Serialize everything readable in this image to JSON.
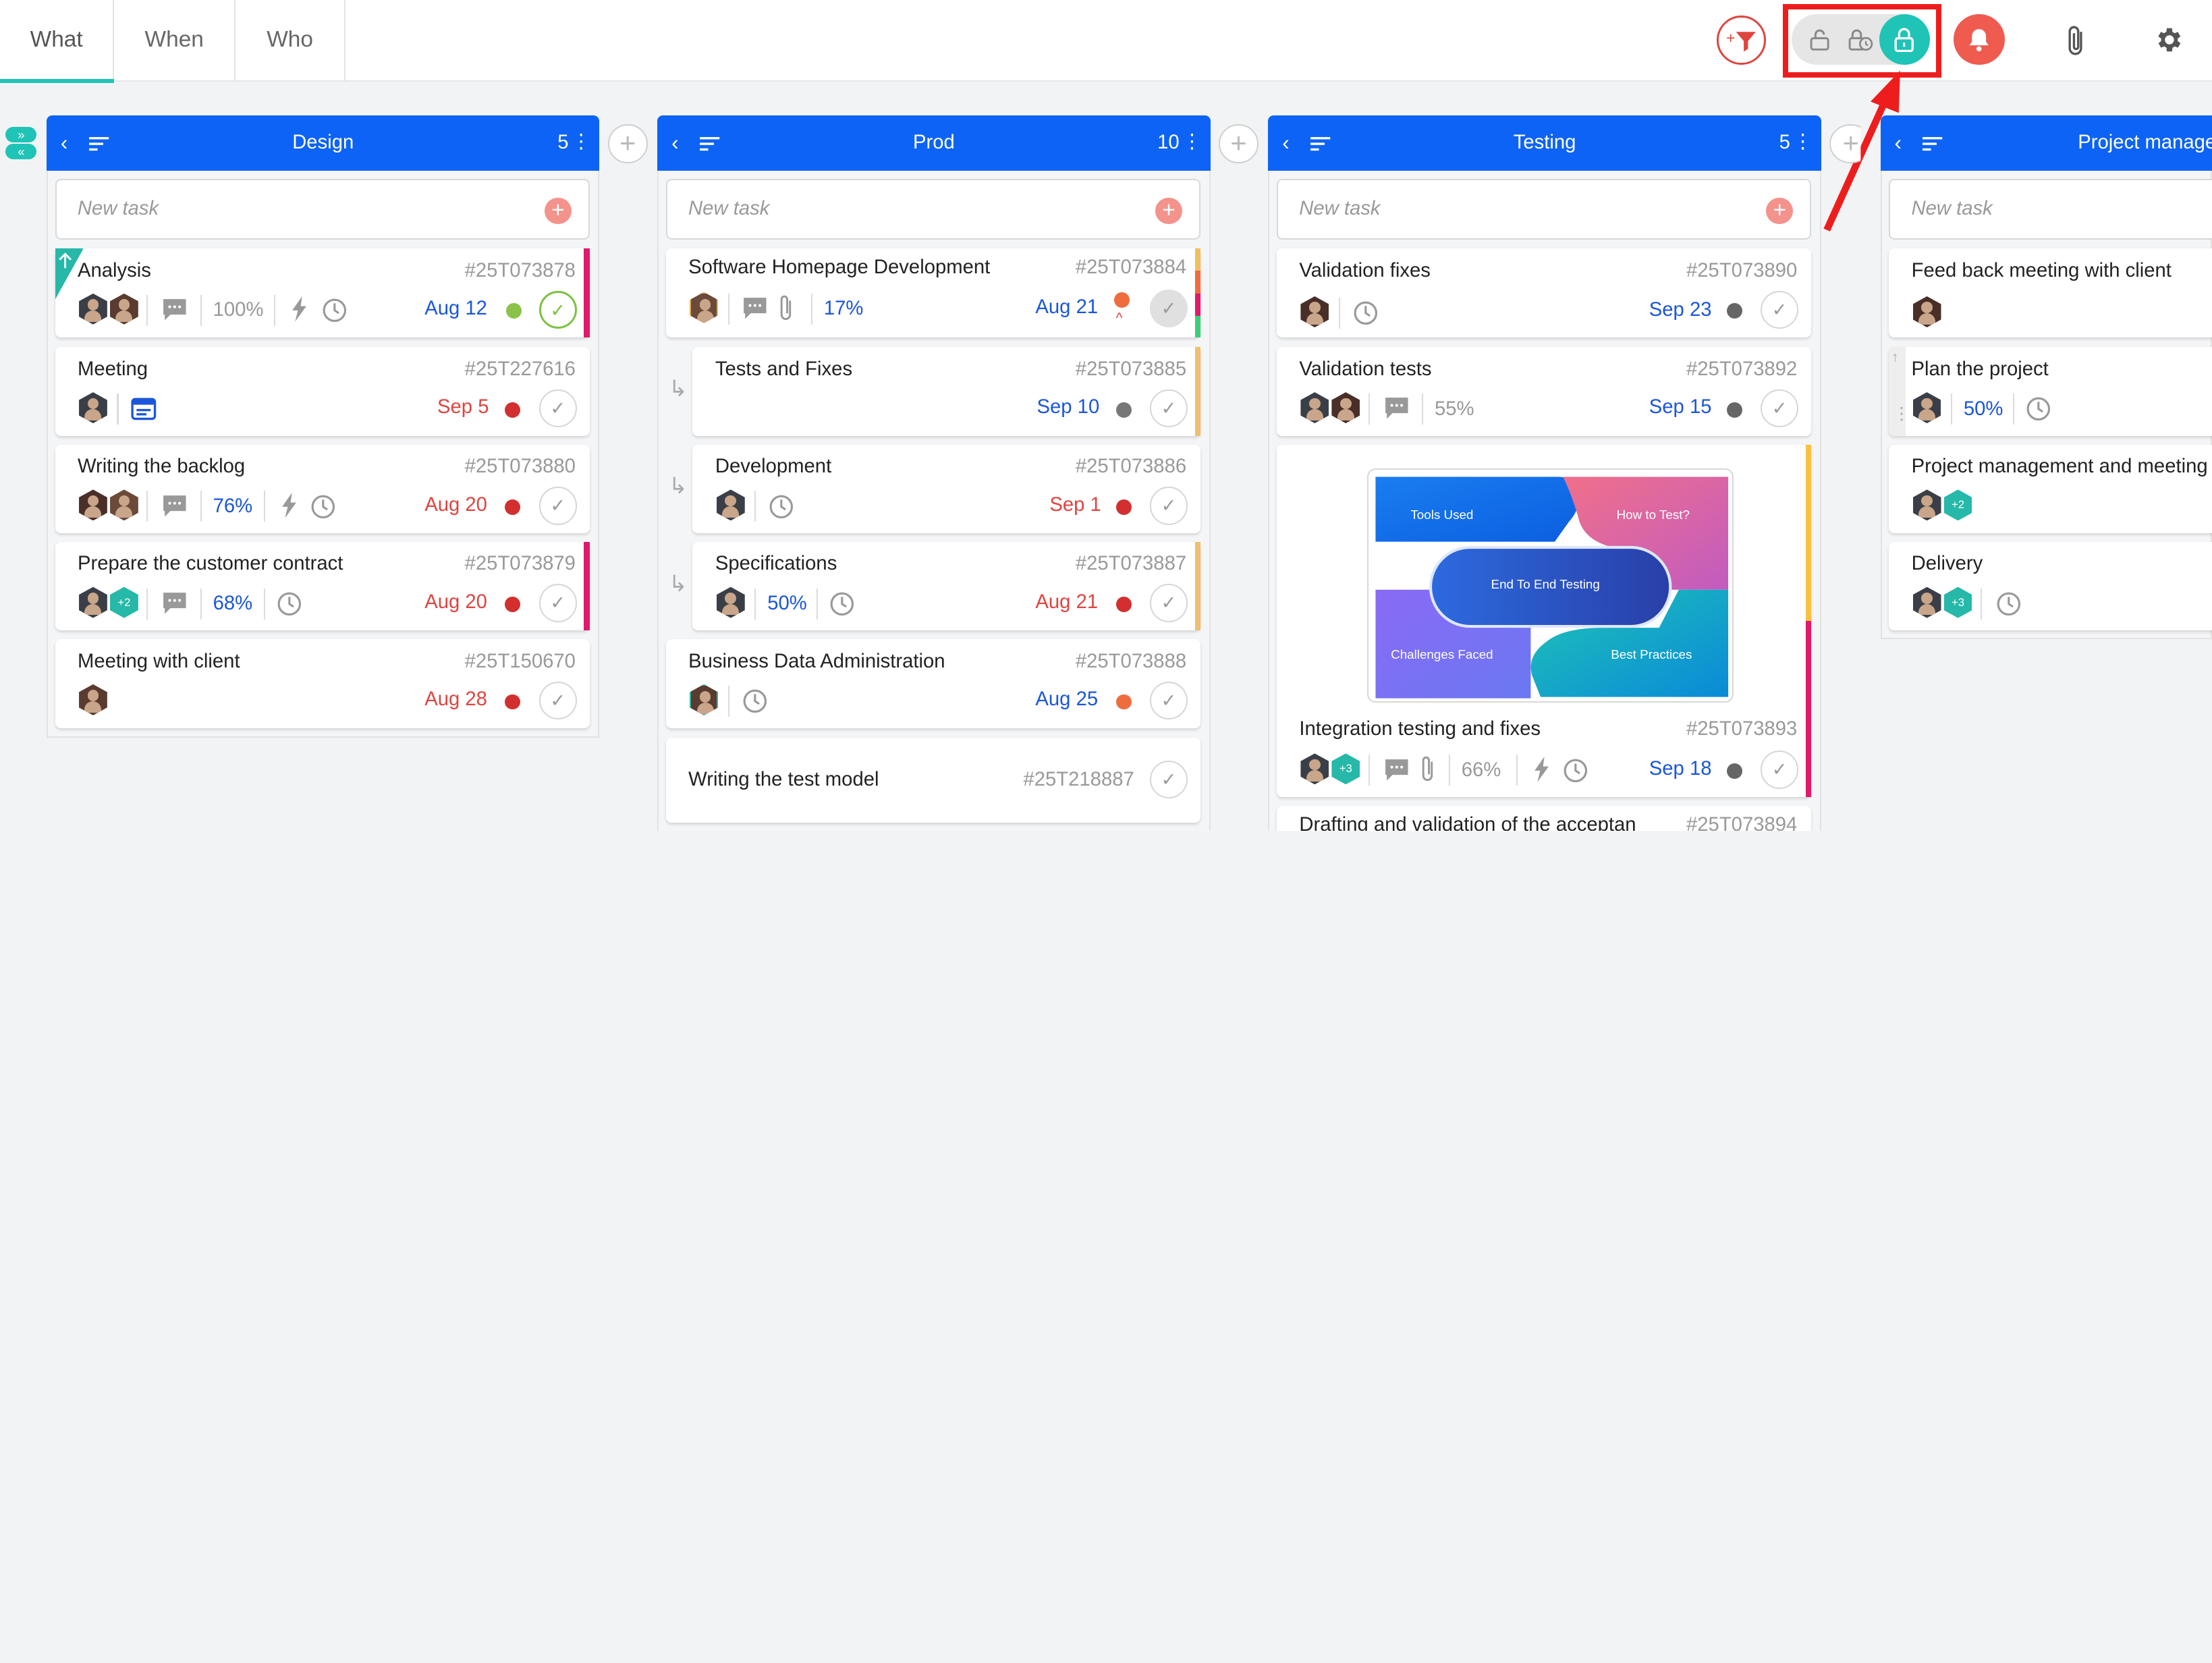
{
  "tabs": [
    {
      "label": "What"
    },
    {
      "label": "When"
    },
    {
      "label": "Who"
    }
  ],
  "colors": {
    "accent": "#1fc4b6",
    "header_blue": "#0d63f5",
    "overdue": "#e0443e",
    "date_blue": "#1a56db",
    "highlight": "#ee1d1d"
  },
  "toolbar_icons": [
    "add-filter-icon",
    "lock-open-icon",
    "lock-clock-icon",
    "lock-active-icon",
    "bell-icon",
    "paperclip-icon",
    "gear-icon"
  ],
  "new_task_placeholder": "New task",
  "columns": [
    {
      "title": "Design",
      "count": "5"
    },
    {
      "title": "Prod",
      "count": "10"
    },
    {
      "title": "Testing",
      "count": "5"
    },
    {
      "title": "Project manage",
      "count": ""
    }
  ],
  "design": [
    {
      "title": "Analysis",
      "id": "#25T073878",
      "progress": "100%",
      "date": "Aug 12"
    },
    {
      "title": "Meeting",
      "id": "#25T227616",
      "date": "Sep 5"
    },
    {
      "title": "Writing the backlog",
      "id": "#25T073880",
      "progress": "76%",
      "date": "Aug 20"
    },
    {
      "title": "Prepare the customer contract",
      "id": "#25T073879",
      "extra": "+2",
      "progress": "68%",
      "date": "Aug 20"
    },
    {
      "title": "Meeting with client",
      "id": "#25T150670",
      "date": "Aug 28"
    }
  ],
  "prod": [
    {
      "title": "Software Homepage Development",
      "id": "#25T073884",
      "progress": "17%",
      "date": "Aug 21"
    },
    {
      "title": "Tests and Fixes",
      "id": "#25T073885",
      "date": "Sep 10"
    },
    {
      "title": "Development",
      "id": "#25T073886",
      "date": "Sep 1"
    },
    {
      "title": "Specifications",
      "id": "#25T073887",
      "progress": "50%",
      "date": "Aug 21"
    },
    {
      "title": "Business Data Administration",
      "id": "#25T073888",
      "date": "Aug 25"
    },
    {
      "title": "Writing the test model",
      "id": "#25T218887"
    }
  ],
  "testing": [
    {
      "title": "Validation fixes",
      "id": "#25T073890",
      "date": "Sep 23"
    },
    {
      "title": "Validation tests",
      "id": "#25T073892",
      "progress": "55%",
      "date": "Sep 15"
    },
    {
      "title": "Integration testing and fixes",
      "id": "#25T073893",
      "extra": "+3",
      "progress": "66%",
      "date": "Sep 18"
    },
    {
      "title": "Drafting and validation of the acceptan",
      "id": "#25T073894"
    }
  ],
  "mosaic": {
    "tl": "Tools Used",
    "tr": "How to Test?",
    "center": "End To End Testing",
    "bl": "Challenges Faced",
    "br": "Best Practices"
  },
  "pm": [
    {
      "title": "Feed back meeting with client"
    },
    {
      "title": "Plan the project",
      "progress": "50%"
    },
    {
      "title": "Project management and meeting",
      "extra": "+2"
    },
    {
      "title": "Delivery",
      "extra": "+3"
    }
  ]
}
